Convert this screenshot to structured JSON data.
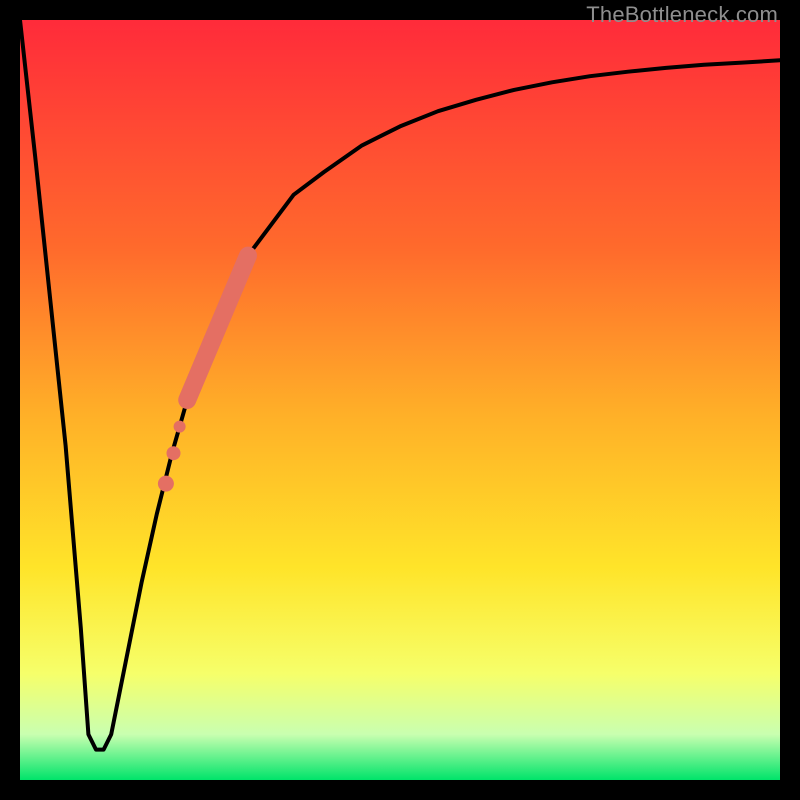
{
  "watermark": "TheBottleneck.com",
  "colors": {
    "gradient_top": "#ff2b3a",
    "gradient_mid1": "#ff6a2c",
    "gradient_mid2": "#ffb028",
    "gradient_mid3": "#ffe429",
    "gradient_mid4": "#f6ff6a",
    "gradient_bottom_light": "#c9ffb0",
    "gradient_bottom": "#00e46a",
    "curve": "#000000",
    "highlight": "#e46f63",
    "frame": "#000000"
  },
  "chart_data": {
    "type": "line",
    "title": "",
    "xlabel": "",
    "ylabel": "",
    "xlim": [
      0,
      100
    ],
    "ylim": [
      0,
      100
    ],
    "series": [
      {
        "name": "bottleneck-curve",
        "x": [
          0,
          2,
          4,
          6,
          8,
          9,
          10,
          11,
          12,
          14,
          16,
          18,
          20,
          22,
          24,
          26,
          28,
          30,
          33,
          36,
          40,
          45,
          50,
          55,
          60,
          65,
          70,
          75,
          80,
          85,
          90,
          95,
          100
        ],
        "y": [
          100,
          82,
          63,
          44,
          20,
          6,
          4,
          4,
          6,
          16,
          26,
          35,
          43,
          50,
          56,
          61,
          65,
          69,
          73,
          77,
          80,
          83.5,
          86,
          88,
          89.5,
          90.8,
          91.8,
          92.6,
          93.2,
          93.7,
          94.1,
          94.4,
          94.7
        ]
      }
    ],
    "highlight_segment": {
      "name": "highlighted-range",
      "style": "thick",
      "x": [
        22,
        30
      ],
      "y": [
        50,
        69
      ]
    },
    "highlight_points": [
      {
        "x": 19.2,
        "y": 39
      },
      {
        "x": 20.2,
        "y": 43
      },
      {
        "x": 21.0,
        "y": 46.5
      }
    ],
    "optimal_x": 10
  }
}
